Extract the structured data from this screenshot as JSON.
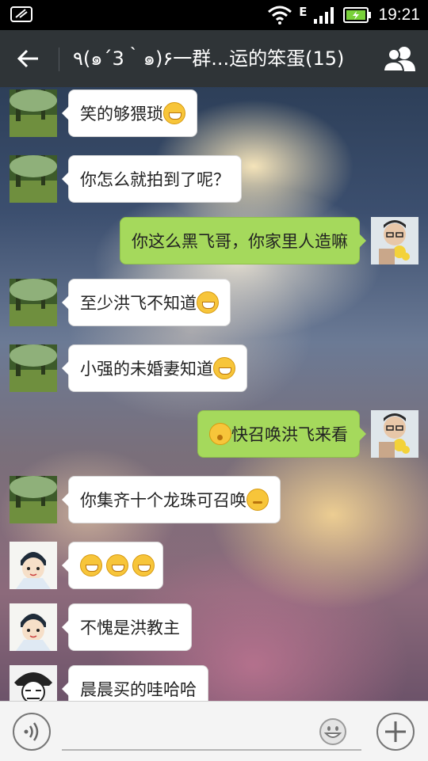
{
  "status_bar": {
    "time": "19:21",
    "network": "E"
  },
  "header": {
    "title": "٩(๑´3｀๑)۶一群...运的笨蛋(15)"
  },
  "messages": [
    {
      "side": "in",
      "avatar": "avatar-park",
      "text": "笑的够猥琐",
      "emoji": "grin"
    },
    {
      "side": "in",
      "avatar": "avatar-park",
      "text": "你怎么就拍到了呢？",
      "emoji": ""
    },
    {
      "side": "out",
      "avatar": "avatar-me",
      "text": "你这么黑飞哥，你家里人造嘛",
      "emoji": ""
    },
    {
      "side": "in",
      "avatar": "avatar-park",
      "text": "至少洪飞不知道",
      "emoji": "grin"
    },
    {
      "side": "in",
      "avatar": "avatar-park",
      "text": "小强的未婚妻知道",
      "emoji": "grin"
    },
    {
      "side": "out",
      "avatar": "avatar-me",
      "text": "快召唤洪飞来看",
      "emoji_before": "wow"
    },
    {
      "side": "in",
      "avatar": "avatar-park",
      "text": "你集齐十个龙珠可召唤",
      "emoji": "think"
    },
    {
      "side": "in",
      "avatar": "avatar-cartoon",
      "text": "",
      "emoji": "grin-x3"
    },
    {
      "side": "in",
      "avatar": "avatar-cartoon",
      "text": "不愧是洪教主",
      "emoji": ""
    },
    {
      "side": "in",
      "avatar": "avatar-sketch",
      "text": "晨晨买的哇哈哈",
      "emoji": ""
    }
  ],
  "input": {
    "placeholder": ""
  },
  "colors": {
    "outgoing_bubble": "#a5d95c",
    "incoming_bubble": "#ffffff",
    "header_bg": "#2f3437"
  }
}
